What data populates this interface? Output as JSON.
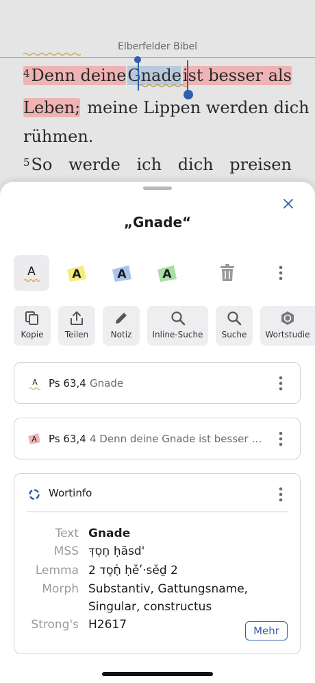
{
  "reader": {
    "bible_title": "Elberfelder Bibel",
    "v4_num": "4",
    "v4_word1": "Denn deine",
    "v4_sel": "Gnade",
    "v4_word2": "ist besser als",
    "v4_line2_hl": "Leben;",
    "v4_line2_rest": "meine Lippen werden dich",
    "v4_line3": "rühmen.",
    "v5_num": "5",
    "v5_words": [
      "So",
      "werde",
      "ich",
      "dich",
      "preisen"
    ]
  },
  "sheet": {
    "title": "„Gnade“",
    "highlight_colors": [
      "#e0b23a",
      "#f6ec82",
      "#a9c4ec",
      "#a8dfa2"
    ],
    "highlight_letter": "A",
    "actions": [
      "Kopie",
      "Teilen",
      "Notiz",
      "Inline-Suche",
      "Suche",
      "Wortstudie"
    ]
  },
  "cards": [
    {
      "ref": "Ps 63,4",
      "text": "Gnade"
    },
    {
      "ref": "Ps 63,4",
      "text": "4 Denn deine Gnade ist besser a…"
    }
  ],
  "wortinfo": {
    "title": "Wortinfo",
    "rows": [
      {
        "label": "Text",
        "value": "Gnade"
      },
      {
        "label": "MSS",
        "value": "חֶסְדְּ ḥăsd'"
      },
      {
        "label": "Lemma",
        "value": "2 חֶ֫סֶד ḥěʹ·sěḏ 2"
      },
      {
        "label": "Morph",
        "value": "Substantiv, Gattungsname,"
      },
      {
        "label": "",
        "value": "Singular, constructus"
      },
      {
        "label": "Strong's",
        "value": "H2617"
      }
    ],
    "more": "Mehr"
  },
  "colors": {
    "accent": "#2f5fab",
    "highlight_red": "#efb3b3",
    "selection": "#b9c8dc"
  }
}
